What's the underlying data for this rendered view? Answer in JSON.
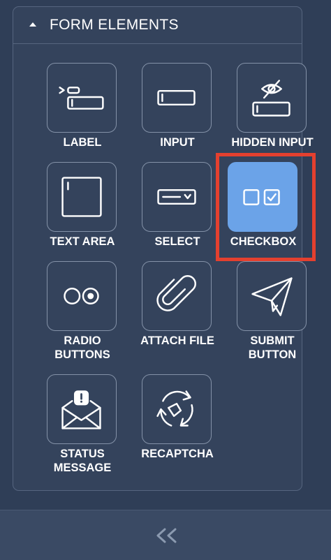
{
  "panel": {
    "title": "FORM ELEMENTS",
    "caret_icon": "caret-up-icon"
  },
  "elements": [
    {
      "key": "label",
      "label": "LABEL",
      "icon": "label-icon"
    },
    {
      "key": "input",
      "label": "INPUT",
      "icon": "input-icon"
    },
    {
      "key": "hidden-input",
      "label": "HIDDEN INPUT",
      "icon": "hidden-input-icon"
    },
    {
      "key": "text-area",
      "label": "TEXT AREA",
      "icon": "text-area-icon"
    },
    {
      "key": "select",
      "label": "SELECT",
      "icon": "select-icon"
    },
    {
      "key": "checkbox",
      "label": "CHECKBOX",
      "icon": "checkbox-icon",
      "selected": true
    },
    {
      "key": "radio-buttons",
      "label": "RADIO\nBUTTONS",
      "icon": "radio-buttons-icon"
    },
    {
      "key": "attach-file",
      "label": "ATTACH FILE",
      "icon": "paperclip-icon"
    },
    {
      "key": "submit-button",
      "label": "SUBMIT\nBUTTON",
      "icon": "paper-plane-icon"
    },
    {
      "key": "status-message",
      "label": "STATUS\nMESSAGE",
      "icon": "envelope-alert-icon"
    },
    {
      "key": "recaptcha",
      "label": "RECAPTCHA",
      "icon": "recaptcha-icon"
    }
  ],
  "footer": {
    "collapse_icon": "double-chevron-left-icon",
    "collapse_glyph": "<<"
  },
  "colors": {
    "background": "#2f3e57",
    "panel": "#34435c",
    "tile_border": "#8492a8",
    "selected_tile": "#6ba3e8",
    "highlight": "#e4402f",
    "icon_stroke": "#ffffff"
  }
}
